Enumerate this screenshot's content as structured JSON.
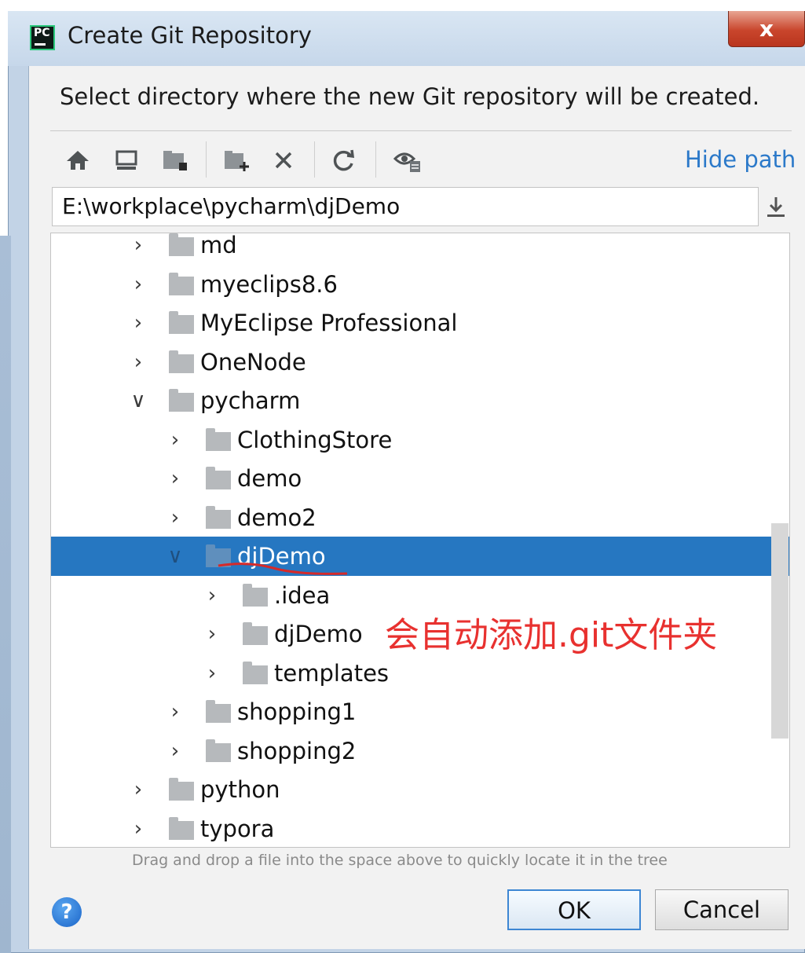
{
  "window": {
    "title": "Create Git Repository",
    "app_icon_text": "PC",
    "close_label": "x"
  },
  "description": "Select directory where the new Git repository will be created.",
  "toolbar": {
    "icons": [
      "home-icon",
      "desktop-icon",
      "project-icon",
      "new-folder-icon",
      "delete-icon",
      "refresh-icon",
      "show-hidden-icon"
    ],
    "hide_path_label": "Hide path"
  },
  "path_field": {
    "value": "E:\\workplace\\pycharm\\djDemo"
  },
  "tree": {
    "items": [
      {
        "label": "md",
        "level": 0,
        "expanded": false,
        "selected": false
      },
      {
        "label": "myeclips8.6",
        "level": 0,
        "expanded": false,
        "selected": false
      },
      {
        "label": "MyEclipse Professional",
        "level": 0,
        "expanded": false,
        "selected": false
      },
      {
        "label": "OneNode",
        "level": 0,
        "expanded": false,
        "selected": false
      },
      {
        "label": "pycharm",
        "level": 0,
        "expanded": true,
        "selected": false
      },
      {
        "label": "ClothingStore",
        "level": 1,
        "expanded": false,
        "selected": false
      },
      {
        "label": "demo",
        "level": 1,
        "expanded": false,
        "selected": false
      },
      {
        "label": "demo2",
        "level": 1,
        "expanded": false,
        "selected": false
      },
      {
        "label": "djDemo",
        "level": 1,
        "expanded": true,
        "selected": true
      },
      {
        "label": ".idea",
        "level": 2,
        "expanded": false,
        "selected": false
      },
      {
        "label": "djDemo",
        "level": 2,
        "expanded": false,
        "selected": false
      },
      {
        "label": "templates",
        "level": 2,
        "expanded": false,
        "selected": false
      },
      {
        "label": "shopping1",
        "level": 1,
        "expanded": false,
        "selected": false
      },
      {
        "label": "shopping2",
        "level": 1,
        "expanded": false,
        "selected": false
      },
      {
        "label": "python",
        "level": 0,
        "expanded": false,
        "selected": false
      },
      {
        "label": "typora",
        "level": 0,
        "expanded": false,
        "selected": false
      }
    ]
  },
  "annotation": "会自动添加.git文件夹",
  "drag_hint": "Drag and drop a file into the space above to quickly locate it in the tree",
  "buttons": {
    "help_label": "?",
    "ok_label": "OK",
    "cancel_label": "Cancel"
  },
  "colors": {
    "selection": "#2677c1",
    "link": "#2b79c9",
    "annotation": "#e8312f"
  }
}
